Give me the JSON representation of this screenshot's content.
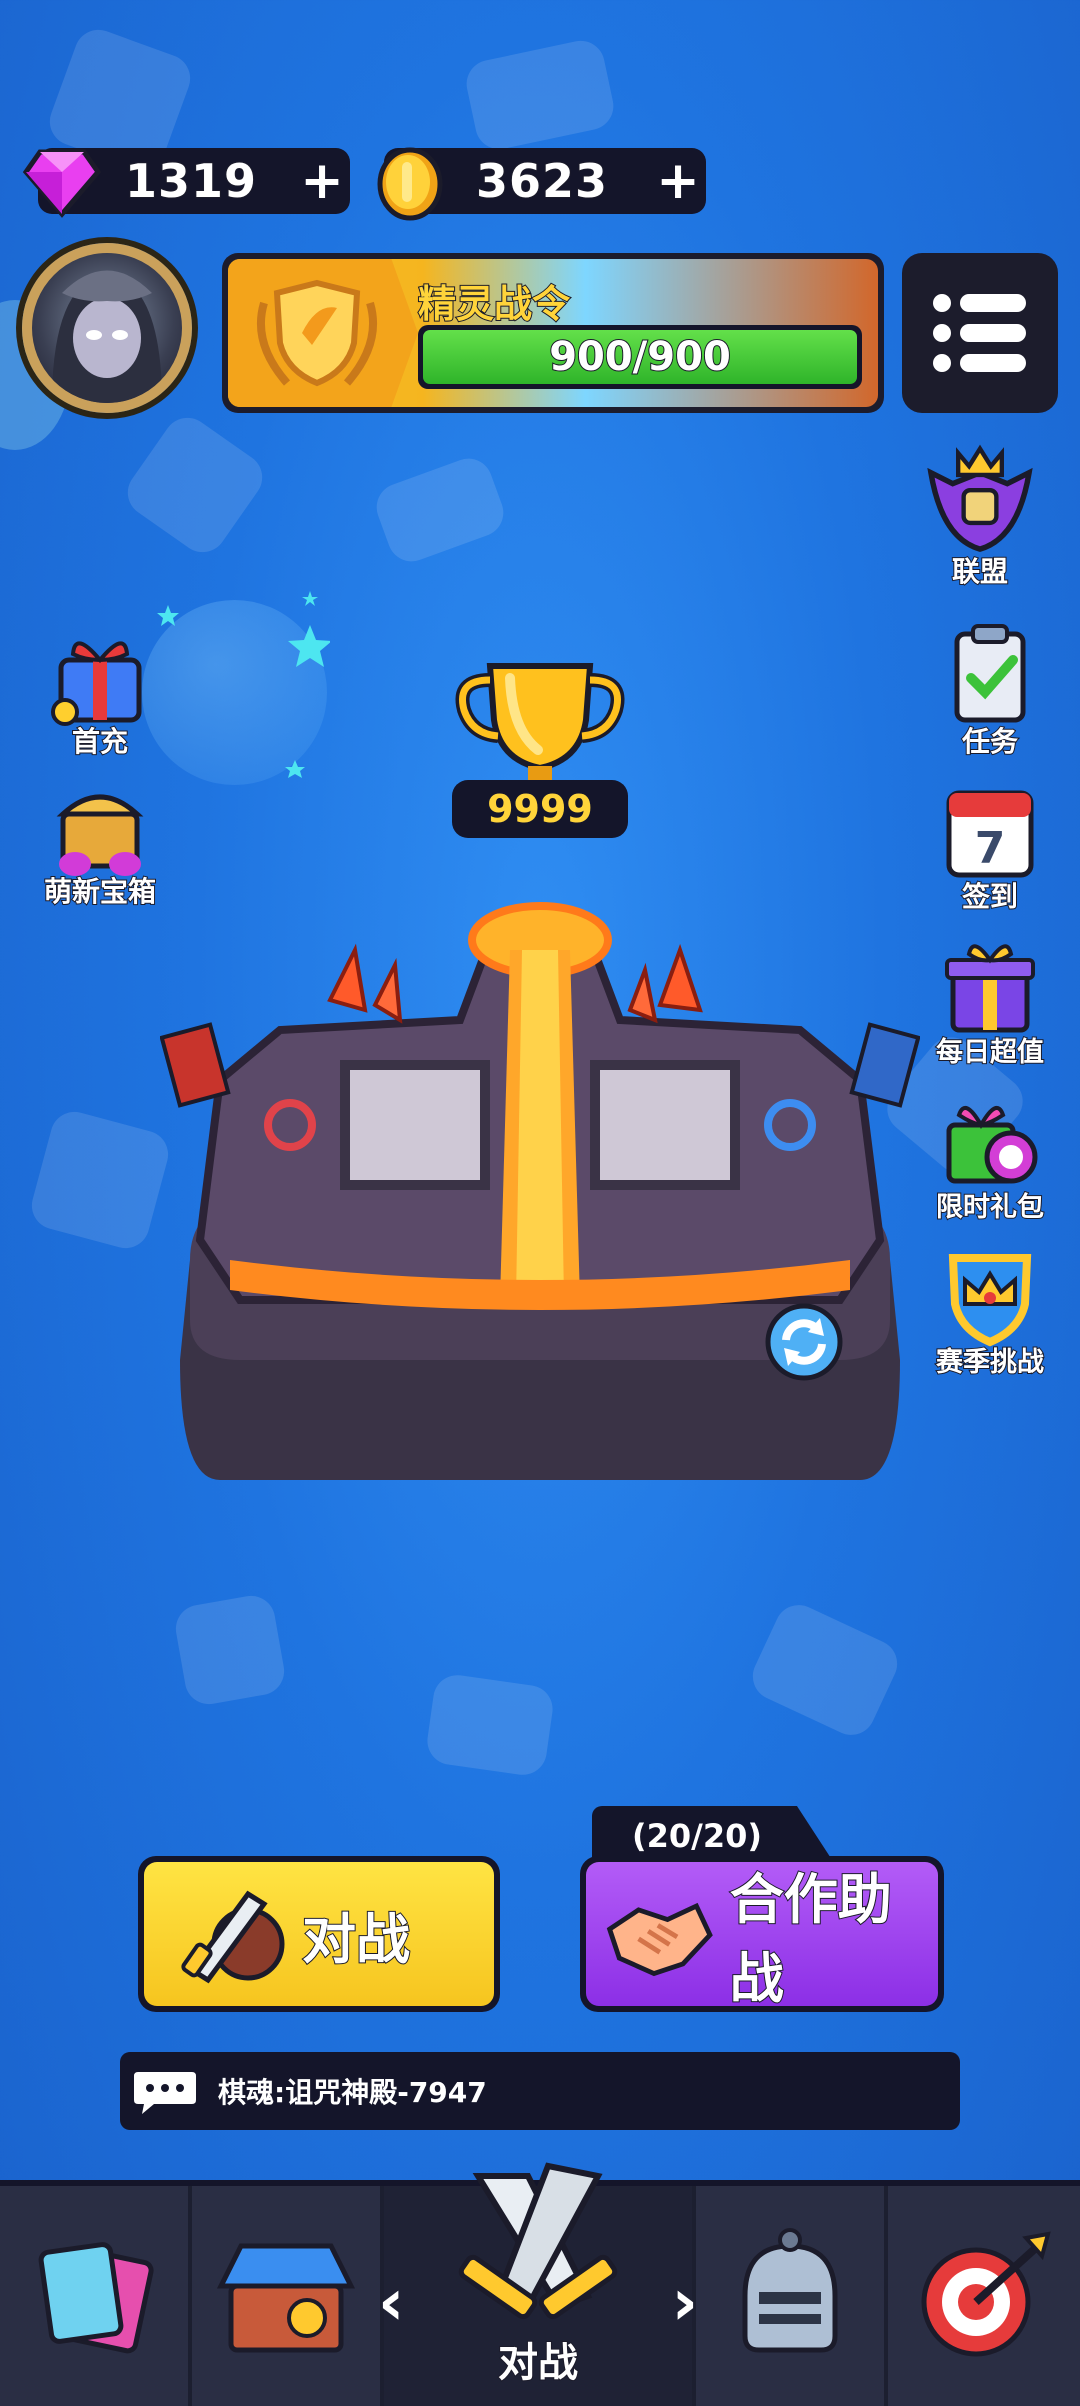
{
  "currency": {
    "gems": {
      "value": "1319",
      "plus": "+",
      "icon": "gem-icon"
    },
    "coins": {
      "value": "3623",
      "plus": "+",
      "icon": "coin-icon"
    }
  },
  "battle_pass": {
    "title": "精灵战令",
    "progress_text": "900/900",
    "progress_fraction": 1.0
  },
  "side_left": [
    {
      "id": "first-charge",
      "label": "首充",
      "icon": "gift-icon"
    },
    {
      "id": "newbie-chest",
      "label": "萌新宝箱",
      "icon": "treasure-chest-icon"
    }
  ],
  "side_right": [
    {
      "id": "alliance",
      "label": "联盟",
      "icon": "alliance-crest-icon"
    },
    {
      "id": "tasks",
      "label": "任务",
      "icon": "clipboard-check-icon"
    },
    {
      "id": "signin",
      "label": "签到",
      "icon": "calendar-icon"
    },
    {
      "id": "daily-value",
      "label": "每日超值",
      "icon": "gift-box-icon"
    },
    {
      "id": "limited-pack",
      "label": "限时礼包",
      "icon": "timed-gift-icon"
    },
    {
      "id": "season-challenge",
      "label": "赛季挑战",
      "icon": "crown-shield-icon"
    }
  ],
  "trophy": {
    "count": "9999"
  },
  "buttons": {
    "battle": "对战",
    "coop": "合作助战",
    "coop_count": "(20/20)"
  },
  "chat": {
    "text": "棋魂:诅咒神殿-7947"
  },
  "nav": {
    "active_label": "对战",
    "left_chevron": "‹",
    "right_chevron": "›"
  },
  "colors": {
    "background": "#1f74e0",
    "panel": "#14152a",
    "gold": "#ffd43a",
    "battle_yellow": "#f6c51f",
    "coop_purple": "#8c2fe6",
    "progress_green": "#2fb42a"
  }
}
